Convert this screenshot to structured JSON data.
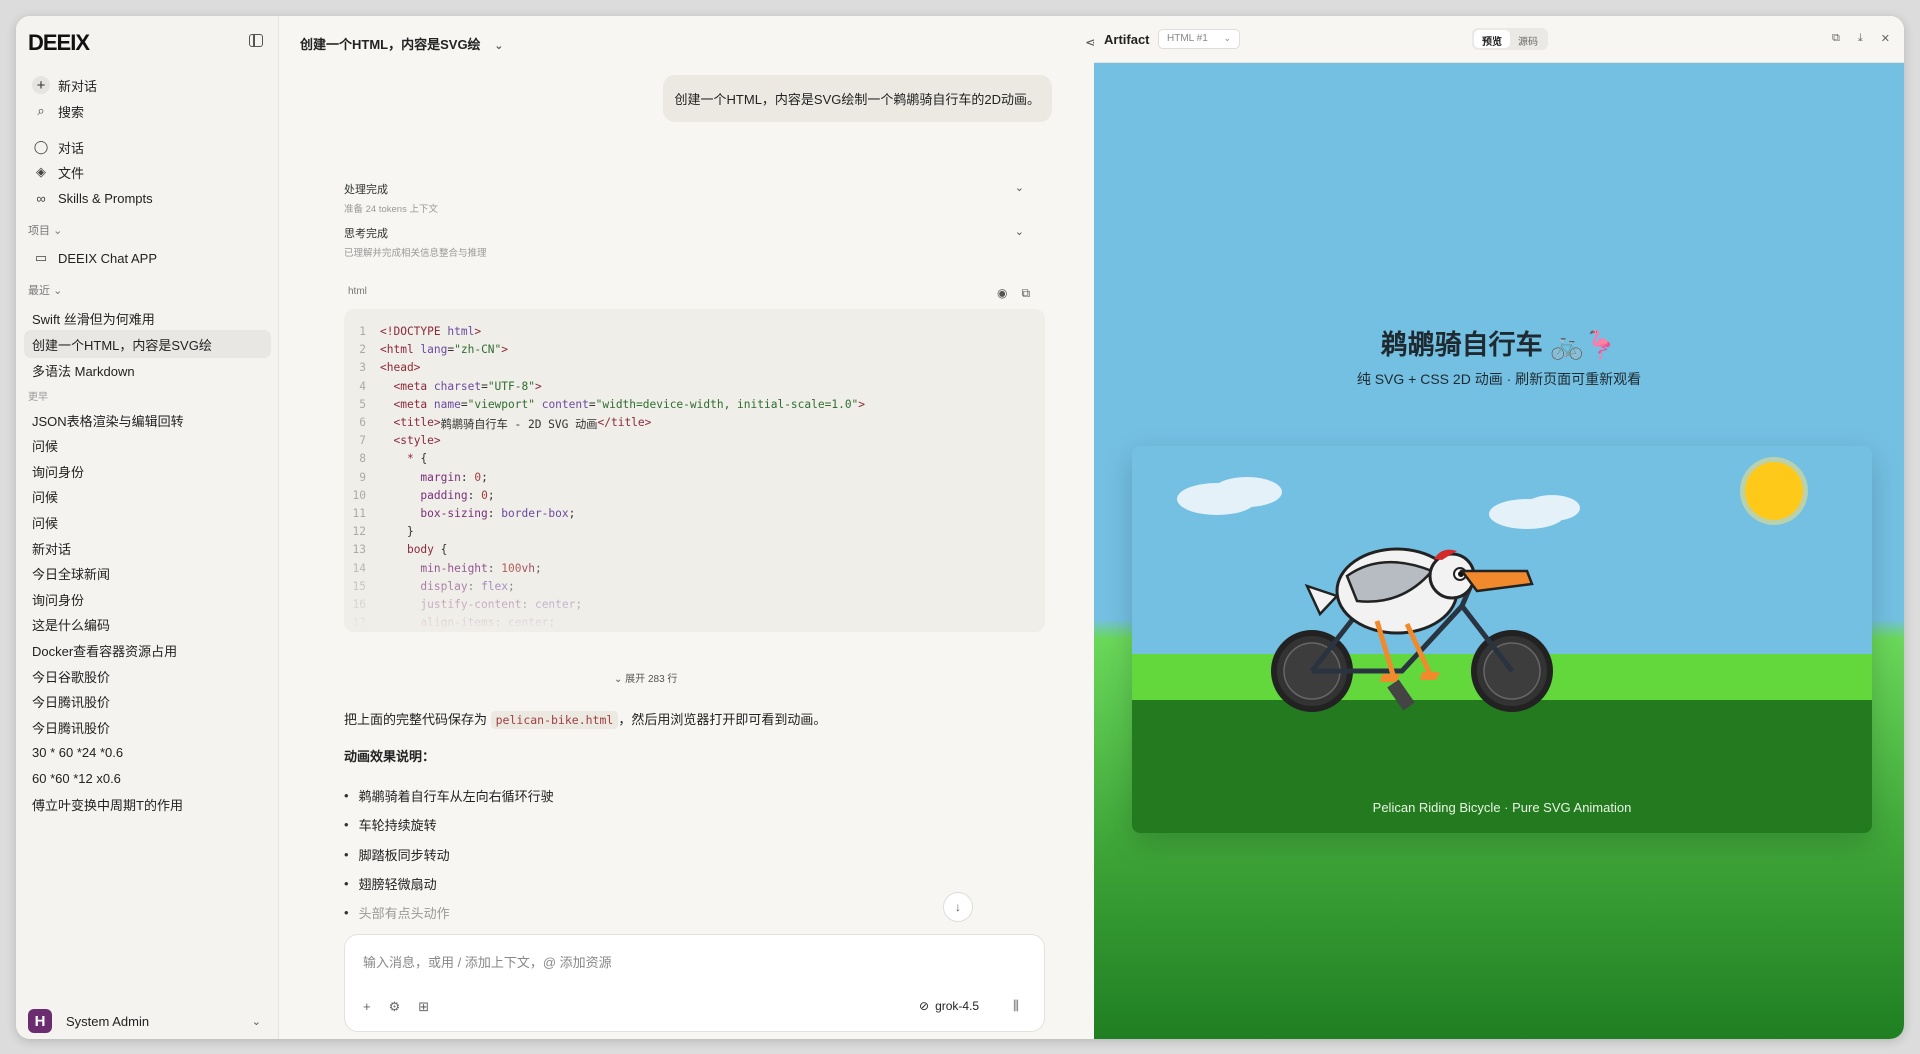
{
  "sidebar": {
    "logo": "DEEIX",
    "new_chat": "新对话",
    "search": "搜索",
    "nav": [
      {
        "label": "对话",
        "icon": "chat-icon"
      },
      {
        "label": "文件",
        "icon": "layers-icon"
      },
      {
        "label": "Skills & Prompts",
        "icon": "link-icon"
      }
    ],
    "projects_label": "项目",
    "projects": [
      "DEEIX Chat APP"
    ],
    "recent_label": "最近",
    "recent": [
      "Swift 丝滑但为何难用",
      "创建一个HTML，内容是SVG绘",
      "多语法 Markdown"
    ],
    "earlier_label": "更早",
    "earlier": [
      "JSON表格渲染与编辑回转",
      "问候",
      "询问身份",
      "问候",
      "问候",
      "新对话",
      "今日全球新闻",
      "询问身份",
      "这是什么编码",
      "Docker查看容器资源占用",
      "今日谷歌股价",
      "今日腾讯股价",
      "今日腾讯股价",
      "30 * 60 *24 *0.6",
      "60 *60 *12 x0.6",
      "傅立叶变换中周期T的作用"
    ],
    "user_name": "System Admin",
    "user_initial": "H"
  },
  "chat": {
    "title": "创建一个HTML，内容是SVG绘",
    "user_message": "创建一个HTML，内容是SVG绘制一个鹈鹕骑自行车的2D动画。",
    "status": [
      {
        "title": "处理完成",
        "sub": "准备 24 tokens 上下文"
      },
      {
        "title": "思考完成",
        "sub": "已理解并完成相关信息整合与推理"
      }
    ],
    "code_lang": "html",
    "code_lines": [
      {
        "n": "1",
        "t": [
          [
            "tag",
            "<!DOCTYPE "
          ],
          [
            "attr",
            "html"
          ],
          [
            "tag",
            ">"
          ]
        ]
      },
      {
        "n": "2",
        "t": [
          [
            "tag",
            "<html "
          ],
          [
            "attr",
            "lang"
          ],
          [
            "plain",
            "="
          ],
          [
            "str",
            "\"zh-CN\""
          ],
          [
            "tag",
            ">"
          ]
        ]
      },
      {
        "n": "3",
        "t": [
          [
            "tag",
            "<head>"
          ]
        ]
      },
      {
        "n": "4",
        "t": [
          [
            "plain",
            "  "
          ],
          [
            "tag",
            "<meta "
          ],
          [
            "attr",
            "charset"
          ],
          [
            "plain",
            "="
          ],
          [
            "str",
            "\"UTF-8\""
          ],
          [
            "tag",
            ">"
          ]
        ]
      },
      {
        "n": "5",
        "t": [
          [
            "plain",
            "  "
          ],
          [
            "tag",
            "<meta "
          ],
          [
            "attr",
            "name"
          ],
          [
            "plain",
            "="
          ],
          [
            "str",
            "\"viewport\" "
          ],
          [
            "attr",
            "content"
          ],
          [
            "plain",
            "="
          ],
          [
            "str",
            "\"width=device-width, initial-scale=1.0\""
          ],
          [
            "tag",
            ">"
          ]
        ]
      },
      {
        "n": "6",
        "t": [
          [
            "plain",
            "  "
          ],
          [
            "tag",
            "<title>"
          ],
          [
            "plain",
            "鹈鹕骑自行车 - 2D SVG 动画"
          ],
          [
            "tag",
            "</title>"
          ]
        ]
      },
      {
        "n": "7",
        "t": [
          [
            "plain",
            "  "
          ],
          [
            "tag",
            "<style>"
          ]
        ]
      },
      {
        "n": "8",
        "t": [
          [
            "plain",
            "    "
          ],
          [
            "tag",
            "* "
          ],
          [
            "plain",
            "{"
          ]
        ]
      },
      {
        "n": "9",
        "t": [
          [
            "plain",
            "      "
          ],
          [
            "prop",
            "margin"
          ],
          [
            "plain",
            ": "
          ],
          [
            "num",
            "0"
          ],
          [
            "plain",
            ";"
          ]
        ]
      },
      {
        "n": "10",
        "t": [
          [
            "plain",
            "      "
          ],
          [
            "prop",
            "padding"
          ],
          [
            "plain",
            ": "
          ],
          [
            "num",
            "0"
          ],
          [
            "plain",
            ";"
          ]
        ]
      },
      {
        "n": "11",
        "t": [
          [
            "plain",
            "      "
          ],
          [
            "prop",
            "box-sizing"
          ],
          [
            "plain",
            ": "
          ],
          [
            "attr",
            "border-box"
          ],
          [
            "plain",
            ";"
          ]
        ]
      },
      {
        "n": "12",
        "t": [
          [
            "plain",
            "    }"
          ]
        ]
      },
      {
        "n": "13",
        "t": [
          [
            "plain",
            "    "
          ],
          [
            "tag",
            "body "
          ],
          [
            "plain",
            "{"
          ]
        ]
      },
      {
        "n": "14",
        "t": [
          [
            "plain",
            "      "
          ],
          [
            "prop",
            "min-height"
          ],
          [
            "plain",
            ": "
          ],
          [
            "num",
            "100"
          ],
          [
            "tag",
            "vh"
          ],
          [
            "plain",
            ";"
          ]
        ]
      },
      {
        "n": "15",
        "t": [
          [
            "plain",
            "      "
          ],
          [
            "prop",
            "display"
          ],
          [
            "plain",
            ": "
          ],
          [
            "attr",
            "flex"
          ],
          [
            "plain",
            ";"
          ]
        ]
      },
      {
        "n": "16",
        "t": [
          [
            "plain",
            "      "
          ],
          [
            "prop",
            "justify-content"
          ],
          [
            "plain",
            ": "
          ],
          [
            "attr",
            "center"
          ],
          [
            "plain",
            ";"
          ]
        ]
      },
      {
        "n": "17",
        "t": [
          [
            "plain",
            "      "
          ],
          [
            "prop",
            "align-items"
          ],
          [
            "plain",
            ": "
          ],
          [
            "attr",
            "center"
          ],
          [
            "plain",
            ";"
          ]
        ]
      }
    ],
    "expand_label": "展开 283 行",
    "answer_pre": "把上面的完整代码保存为 ",
    "answer_file": "pelican-bike.html",
    "answer_post": "，然后用浏览器打开即可看到动画。",
    "effects_heading": "动画效果说明：",
    "effects": [
      "鹈鹕骑着自行车从左向右循环行驶",
      "车轮持续旋转",
      "脚踏板同步转动",
      "翅膀轻微扇动",
      "头部有点头动作"
    ],
    "composer_placeholder": "输入消息，或用 / 添加上下文，@ 添加资源",
    "model": "grok-4.5"
  },
  "artifact": {
    "label": "Artifact",
    "select": "HTML #1",
    "tab_preview": "预览",
    "tab_source": "源码",
    "preview_title": "鹈鹕骑自行车 🚲🦩",
    "preview_sub": "纯 SVG + CSS 2D 动画 · 刷新页面可重新观看",
    "scene_caption": "Pelican Riding Bicycle · Pure SVG Animation"
  },
  "colors": {
    "sky": "#74c0e3",
    "grass": "#5ac538",
    "ground": "#2a7f22",
    "sun": "#ffd21a",
    "beak": "#f08a2c"
  }
}
